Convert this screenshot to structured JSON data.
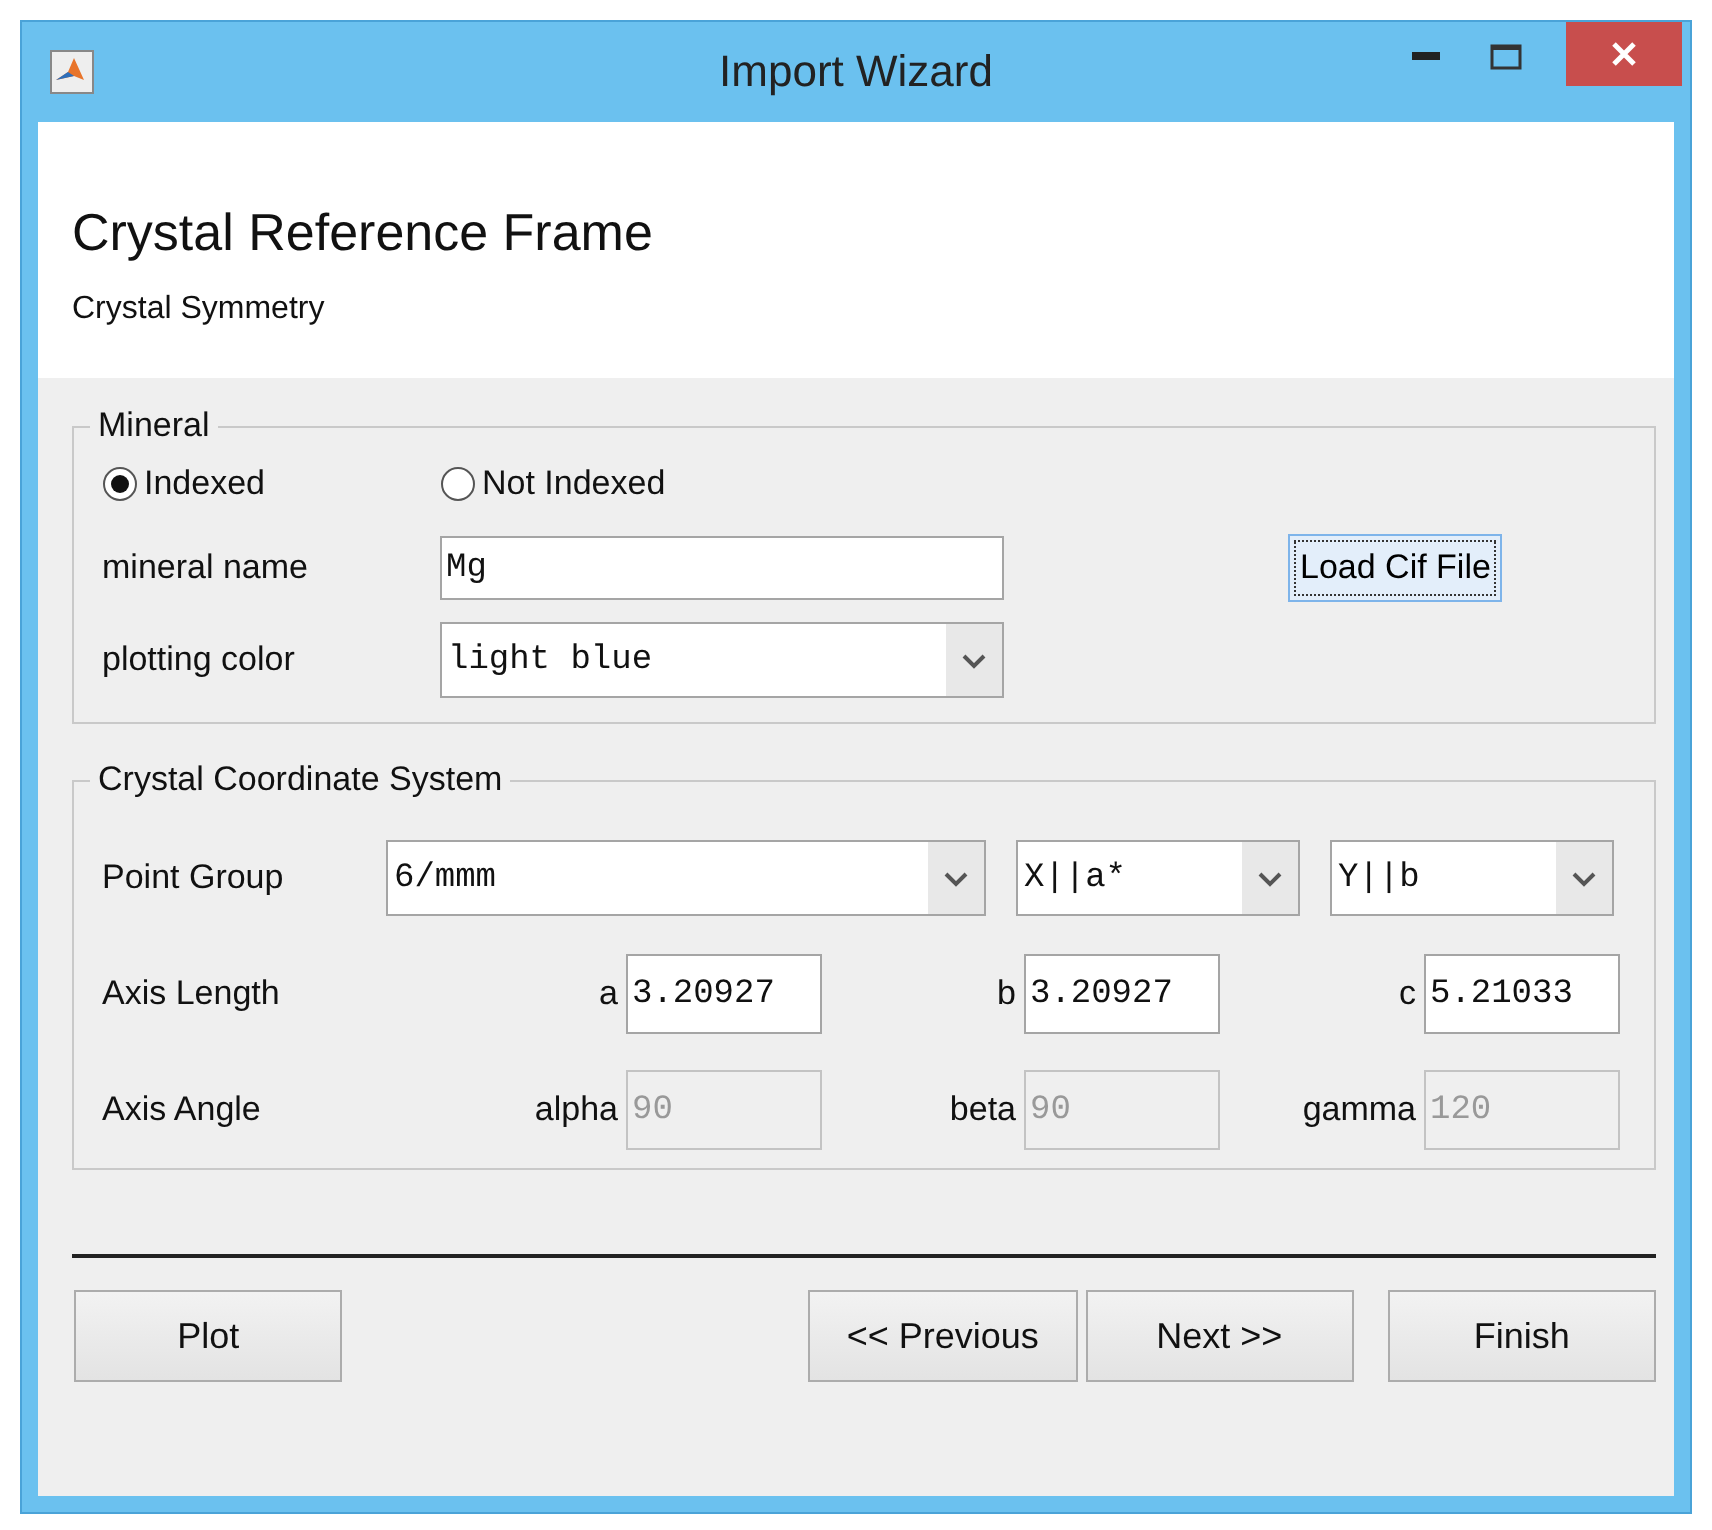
{
  "window": {
    "title": "Import Wizard"
  },
  "header": {
    "title": "Crystal Reference Frame",
    "subtitle": "Crystal Symmetry"
  },
  "mineral": {
    "legend": "Mineral",
    "radios": [
      {
        "label": "Indexed",
        "selected": true
      },
      {
        "label": "Not Indexed",
        "selected": false
      }
    ],
    "name_label": "mineral name",
    "name_value": "Mg",
    "color_label": "plotting color",
    "color_value": "light blue",
    "load_button": {
      "label": "Load Cif File",
      "focused": true
    }
  },
  "coordinate_system": {
    "legend": "Crystal Coordinate System",
    "point_group": {
      "label": "Point Group",
      "selects": [
        "6/mmm",
        "X||a*",
        "Y||b"
      ]
    },
    "rows": [
      {
        "label": "Axis Length",
        "params": [
          {
            "name": "a",
            "value": "3.20927",
            "disabled": false
          },
          {
            "name": "b",
            "value": "3.20927",
            "disabled": false
          },
          {
            "name": "c",
            "value": "5.21033",
            "disabled": false
          }
        ]
      },
      {
        "label": "Axis Angle",
        "params": [
          {
            "name": "alpha",
            "value": "90",
            "disabled": true
          },
          {
            "name": "beta",
            "value": "90",
            "disabled": true
          },
          {
            "name": "gamma",
            "value": "120",
            "disabled": true
          }
        ]
      }
    ]
  },
  "buttons": [
    {
      "label": "Plot"
    },
    {
      "label": "<< Previous"
    },
    {
      "label": "Next >>"
    },
    {
      "label": "Finish"
    }
  ]
}
